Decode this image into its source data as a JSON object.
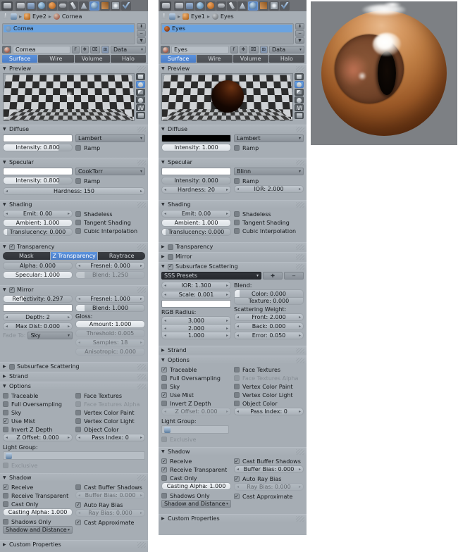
{
  "iconbar": {
    "buttons": [
      {
        "name": "editor-type-button",
        "glyph": "editor-type-icon",
        "active": false
      },
      {
        "name": "render-properties-tab",
        "glyph": "render-icon",
        "active": false
      },
      {
        "name": "scene-properties-tab",
        "glyph": "scene-icon",
        "active": false
      },
      {
        "name": "world-properties-tab",
        "glyph": "world-icon",
        "active": false
      },
      {
        "name": "object-properties-tab",
        "glyph": "object-icon",
        "active": false
      },
      {
        "name": "constraints-properties-tab",
        "glyph": "constraint-icon",
        "active": false
      },
      {
        "name": "modifiers-properties-tab",
        "glyph": "wrench-icon",
        "active": false
      },
      {
        "name": "object-data-properties-tab",
        "glyph": "data-icon",
        "active": false
      },
      {
        "name": "material-properties-tab",
        "glyph": "material-icon",
        "active": true
      },
      {
        "name": "texture-properties-tab",
        "glyph": "texture-icon",
        "active": false
      },
      {
        "name": "particles-properties-tab",
        "glyph": "particles-icon",
        "active": false
      },
      {
        "name": "physics-properties-tab",
        "glyph": "physics-icon",
        "active": false
      }
    ]
  },
  "left": {
    "breadcrumb": {
      "pin_icon": "pin-icon",
      "nodes_icon": "node-tree-icon",
      "object": "Eye2",
      "material": "Cornea",
      "separator": "▸"
    },
    "slots": [
      {
        "label": "Cornea",
        "selected": true,
        "icon": "material-slot-icon"
      }
    ],
    "slot_buttons": [
      "⬍",
      "−",
      "▼"
    ],
    "material_name": "Cornea",
    "fake_user_label": "F",
    "new_material_icon": "✥",
    "unlink_icon": "⌧",
    "nodes_icon": "⊞",
    "data_selector": "Data",
    "tabs": [
      {
        "label": "Surface",
        "active": true
      },
      {
        "label": "Wire",
        "active": false
      },
      {
        "label": "Volume",
        "active": false
      },
      {
        "label": "Halo",
        "active": false
      }
    ],
    "preview": {
      "title": "Preview",
      "buttons": [
        "preview-flat-icon",
        "preview-sphere-icon",
        "preview-cube-icon",
        "preview-monkey-icon",
        "preview-hair-icon",
        "preview-scene-icon"
      ],
      "active_button": 1,
      "sphere_visible": false
    },
    "diffuse": {
      "title": "Diffuse",
      "color": "#ffffff",
      "shader": "Lambert",
      "intensity": "Intensity: 0.800",
      "intensity_fill": 0.8,
      "ramp": "Ramp",
      "ramp_checked": false
    },
    "specular": {
      "title": "Specular",
      "color": "#ffffff",
      "shader": "CookTorr",
      "intensity": "Intensity: 0.800",
      "intensity_fill": 0.8,
      "ramp": "Ramp",
      "ramp_checked": false,
      "hardness": "Hardness: 150"
    },
    "shading": {
      "title": "Shading",
      "emit": "Emit: 0.00",
      "ambient": "Ambient: 1.000",
      "ambient_fill": 1.0,
      "translucency": "Translucency: 0.000",
      "translucency_fill": 0.05,
      "shadeless": "Shadeless",
      "shadeless_checked": false,
      "tangent_shading": "Tangent Shading",
      "tangent_checked": false,
      "cubic": "Cubic Interpolation",
      "cubic_checked": false
    },
    "transparency": {
      "title": "Transparency",
      "enabled": true,
      "modes": [
        {
          "label": "Mask",
          "active": false
        },
        {
          "label": "Z Transparency",
          "active": true
        },
        {
          "label": "Raytrace",
          "active": false
        }
      ],
      "alpha": "Alpha: 0.000",
      "alpha_fill": 0.0,
      "specular": "Specular: 1.000",
      "specular_fill": 1.0,
      "fresnel": "Fresnel: 0.000",
      "blend": "Blend: 1.250",
      "blend_dim": true
    },
    "mirror": {
      "title": "Mirror",
      "enabled": true,
      "reflectivity": "Reflectivity: 0.297",
      "reflectivity_fill": 0.297,
      "mirror_color": "#ffffff",
      "depth": "Depth: 2",
      "max_dist": "Max Dist: 0.000",
      "fade_to_label": "Fade To:",
      "fade_to_value": "Sky",
      "fresnel": "Fresnel: 1.000",
      "blend": "Blend: 1.000",
      "blend_fill": 0.12,
      "gloss_label": "Gloss:",
      "gloss_amount": "Amount: 1.000",
      "gloss_amount_fill": 1.0,
      "gloss_threshold": "Threshold: 0.005",
      "gloss_samples": "Samples: 18",
      "gloss_aniso": "Anisotropic: 0.000"
    },
    "sss": {
      "title": "Subsurface Scattering",
      "enabled": false,
      "expanded": false
    },
    "strand": {
      "title": "Strand",
      "expanded": false
    },
    "options": {
      "title": "Options",
      "left": [
        {
          "label": "Traceable",
          "checked": false,
          "dim": false
        },
        {
          "label": "Full Oversampling",
          "checked": false,
          "dim": false
        },
        {
          "label": "Sky",
          "checked": false,
          "dim": false
        },
        {
          "label": "Use Mist",
          "checked": true,
          "dim": false
        },
        {
          "label": "Invert Z Depth",
          "checked": false,
          "dim": false
        }
      ],
      "right": [
        {
          "label": "Face Textures",
          "checked": false,
          "dim": false
        },
        {
          "label": "Face Textures Alpha",
          "checked": false,
          "dim": true
        },
        {
          "label": "Vertex Color Paint",
          "checked": false,
          "dim": false
        },
        {
          "label": "Vertex Color Light",
          "checked": false,
          "dim": false
        },
        {
          "label": "Object Color",
          "checked": false,
          "dim": false
        }
      ],
      "z_offset": "Z Offset: 0.000",
      "z_offset_dim": false,
      "pass_index": "Pass Index: 0",
      "light_group_label": "Light Group:",
      "light_group_value": "",
      "exclusive": "Exclusive",
      "exclusive_dim": true
    },
    "shadow": {
      "title": "Shadow",
      "left": [
        {
          "label": "Receive",
          "checked": true,
          "dim": false
        },
        {
          "label": "Receive Transparent",
          "checked": false,
          "dim": false
        },
        {
          "label": "Cast Only",
          "checked": false,
          "dim": false
        }
      ],
      "casting_alpha": "Casting Alpha: 1.000",
      "casting_alpha_fill": 1.0,
      "shadows_only": "Shadows Only",
      "shadows_only_checked": false,
      "shadow_mode": "Shadow and Distance",
      "cast_buffer": "Cast Buffer Shadows",
      "cast_buffer_checked": false,
      "buffer_bias": "Buffer Bias: 0.000",
      "buffer_bias_dim": true,
      "auto_ray_bias": "Auto Ray Bias",
      "auto_ray_bias_checked": true,
      "ray_bias": "Ray Bias: 0.000",
      "ray_bias_dim": true,
      "cast_approximate": "Cast Approximate",
      "cast_approximate_checked": true
    },
    "custom_properties": {
      "title": "Custom Properties"
    }
  },
  "right": {
    "breadcrumb": {
      "object": "Eye1",
      "material": "Eyes",
      "separator": "▸"
    },
    "slots": [
      {
        "label": "Eyes",
        "selected": true,
        "icon": "material-slot-icon"
      }
    ],
    "slot_buttons": [
      "⬍",
      "−",
      "▼"
    ],
    "material_name": "Eyes",
    "fake_user_label": "F",
    "data_selector": "Data",
    "tabs": [
      {
        "label": "Surface",
        "active": true
      },
      {
        "label": "Wire",
        "active": false
      },
      {
        "label": "Volume",
        "active": false
      },
      {
        "label": "Halo",
        "active": false
      }
    ],
    "preview": {
      "title": "Preview",
      "active_button": 1,
      "sphere_visible": true
    },
    "diffuse": {
      "title": "Diffuse",
      "color": "#000000",
      "shader": "Lambert",
      "intensity": "Intensity: 1.000",
      "intensity_fill": 1.0,
      "ramp": "Ramp",
      "ramp_checked": false
    },
    "specular": {
      "title": "Specular",
      "color": "#ffffff",
      "shader": "Blinn",
      "intensity": "Intensity: 0.000",
      "intensity_fill": 0.0,
      "ramp": "Ramp",
      "ramp_checked": false,
      "hardness": "Hardness: 20",
      "ior": "IOR: 2.000"
    },
    "shading": {
      "title": "Shading",
      "emit": "Emit: 0.00",
      "ambient": "Ambient: 1.000",
      "ambient_fill": 1.0,
      "translucency": "Translucency: 0.000",
      "translucency_fill": 0.05,
      "shadeless": "Shadeless",
      "shadeless_checked": false,
      "tangent_shading": "Tangent Shading",
      "tangent_checked": false,
      "cubic": "Cubic Interpolation",
      "cubic_checked": false
    },
    "transparency": {
      "title": "Transparency",
      "enabled": false,
      "expanded": false
    },
    "mirror": {
      "title": "Mirror",
      "enabled": false,
      "expanded": false
    },
    "sss": {
      "title": "Subsurface Scattering",
      "enabled": true,
      "presets": "SSS Presets",
      "preset_add": "✚",
      "preset_remove": "−",
      "ior": "IOR: 1.300",
      "scale": "Scale: 0.001",
      "sss_color": "#ffffff",
      "rgb_radius_label": "RGB Radius:",
      "radius_r": "3.000",
      "radius_g": "2.000",
      "radius_b": "1.000",
      "blend_label": "Blend:",
      "blend_color": "Color: 0.000",
      "blend_texture": "Texture: 0.000",
      "scattering_label": "Scattering Weight:",
      "front": "Front: 2.000",
      "back": "Back: 0.000",
      "error": "Error: 0.050"
    },
    "strand": {
      "title": "Strand",
      "expanded": false
    },
    "options": {
      "title": "Options",
      "left": [
        {
          "label": "Traceable",
          "checked": true,
          "dim": false
        },
        {
          "label": "Full Oversampling",
          "checked": false,
          "dim": false
        },
        {
          "label": "Sky",
          "checked": false,
          "dim": false
        },
        {
          "label": "Use Mist",
          "checked": true,
          "dim": false
        },
        {
          "label": "Invert Z Depth",
          "checked": false,
          "dim": false
        }
      ],
      "right": [
        {
          "label": "Face Textures",
          "checked": false,
          "dim": false
        },
        {
          "label": "Face Textures Alpha",
          "checked": false,
          "dim": true
        },
        {
          "label": "Vertex Color Paint",
          "checked": false,
          "dim": false
        },
        {
          "label": "Vertex Color Light",
          "checked": false,
          "dim": false
        },
        {
          "label": "Object Color",
          "checked": false,
          "dim": false
        }
      ],
      "z_offset": "Z Offset: 0.000",
      "z_offset_dim": true,
      "pass_index": "Pass Index: 0",
      "light_group_label": "Light Group:",
      "light_group_value": "",
      "exclusive": "Exclusive",
      "exclusive_dim": true
    },
    "shadow": {
      "title": "Shadow",
      "left": [
        {
          "label": "Receive",
          "checked": true,
          "dim": false
        },
        {
          "label": "Receive Transparent",
          "checked": true,
          "dim": false
        },
        {
          "label": "Cast Only",
          "checked": false,
          "dim": false
        }
      ],
      "casting_alpha": "Casting Alpha: 1.000",
      "casting_alpha_fill": 1.0,
      "shadows_only": "Shadows Only",
      "shadows_only_checked": false,
      "shadow_mode": "Shadow and Distance",
      "cast_buffer": "Cast Buffer Shadows",
      "cast_buffer_checked": true,
      "buffer_bias": "Buffer Bias: 0.000",
      "buffer_bias_dim": false,
      "auto_ray_bias": "Auto Ray Bias",
      "auto_ray_bias_checked": true,
      "ray_bias": "Ray Bias: 0.000",
      "ray_bias_dim": true,
      "cast_approximate": "Cast Approximate",
      "cast_approximate_checked": true
    },
    "custom_properties": {
      "title": "Custom Properties"
    }
  },
  "render": {
    "name": "eye-render-preview",
    "background": "#7d8084",
    "description": "Rendered orange-brown eyeball with vertical slit pupil and specular highlights"
  }
}
